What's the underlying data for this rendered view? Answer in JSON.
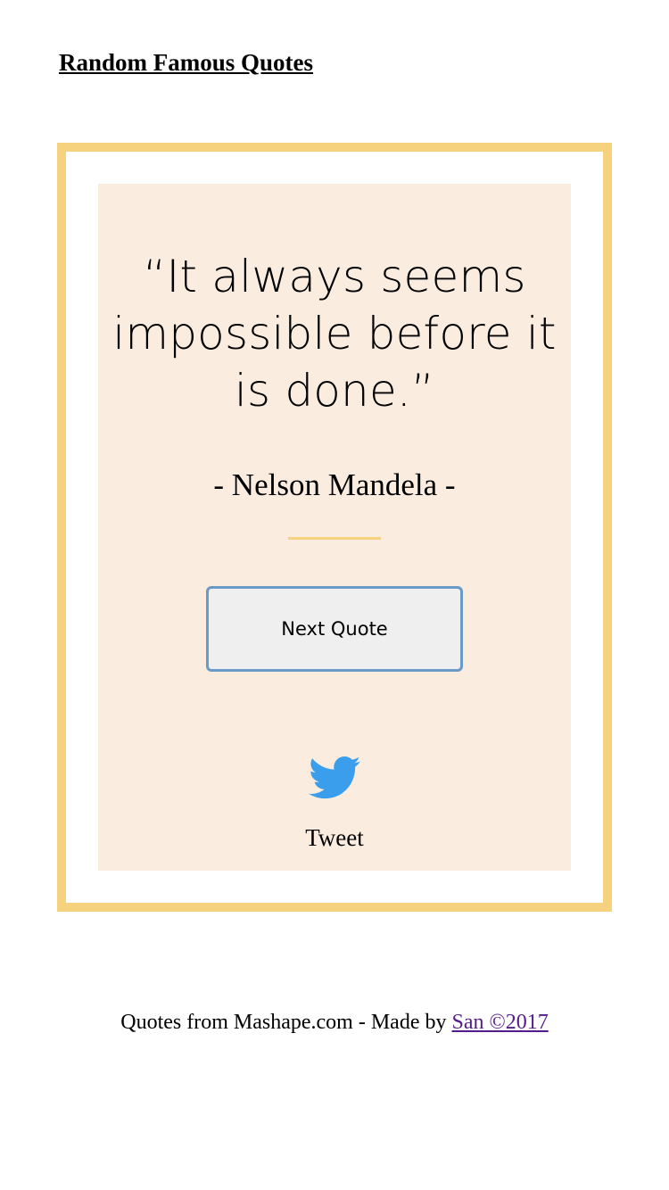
{
  "header": {
    "title": "Random Famous Quotes"
  },
  "quote": {
    "lines": [
      "“It always seems",
      "impossible before it",
      "is done.”"
    ],
    "author": "- Nelson Mandela -"
  },
  "actions": {
    "next_quote_label": "Next Quote",
    "tweet_label": "Tweet",
    "tweet_icon": "twitter-bird-icon"
  },
  "footer": {
    "text": "Quotes from Mashape.com - Made by ",
    "author_link": "San ©2017"
  },
  "colors": {
    "frame_accent": "#f7d27e",
    "card_background": "#faede0",
    "button_border": "#6a9ac6",
    "button_background": "#efefef",
    "twitter_blue": "#3a9eec",
    "visited_link": "#551a8b"
  }
}
